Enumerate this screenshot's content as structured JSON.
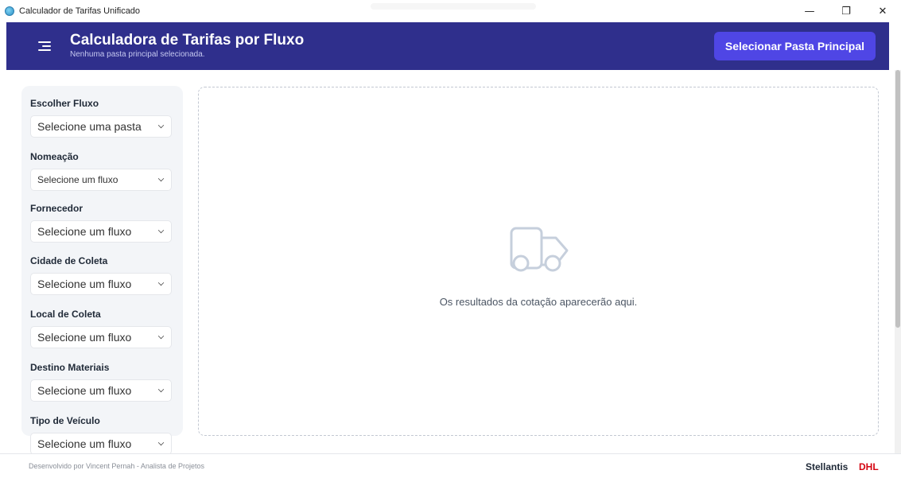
{
  "window": {
    "title": "Calculador de Tarifas Unificado",
    "controls": {
      "minimize": "—",
      "restore": "❐",
      "close": "✕"
    }
  },
  "header": {
    "title": "Calculadora de Tarifas por Fluxo",
    "subtitle": "Nenhuma pasta principal selecionada.",
    "select_folder_label": "Selecionar Pasta Principal"
  },
  "sidebar": {
    "fields": [
      {
        "label": "Escolher Fluxo",
        "value": "Selecione uma pasta"
      },
      {
        "label": "Nomeação",
        "value": "Selecione um fluxo"
      },
      {
        "label": "Fornecedor",
        "value": "Selecione um fluxo"
      },
      {
        "label": "Cidade de Coleta",
        "value": "Selecione um fluxo"
      },
      {
        "label": "Local de Coleta",
        "value": "Selecione um fluxo"
      },
      {
        "label": "Destino Materiais",
        "value": "Selecione um fluxo"
      },
      {
        "label": "Tipo de Veículo",
        "value": "Selecione um fluxo"
      }
    ]
  },
  "results": {
    "icon": "truck-icon",
    "placeholder": "Os resultados da cotação aparecerão aqui."
  },
  "footer": {
    "credit": "Desenvolvido por Vincent Pernah - Analista de Projetos",
    "brand_stellantis": "Stellantis",
    "brand_dhl": "DHL"
  },
  "colors": {
    "header_bg": "#2f2f8c",
    "accent": "#4f46e5",
    "dhl_red": "#d40511"
  }
}
